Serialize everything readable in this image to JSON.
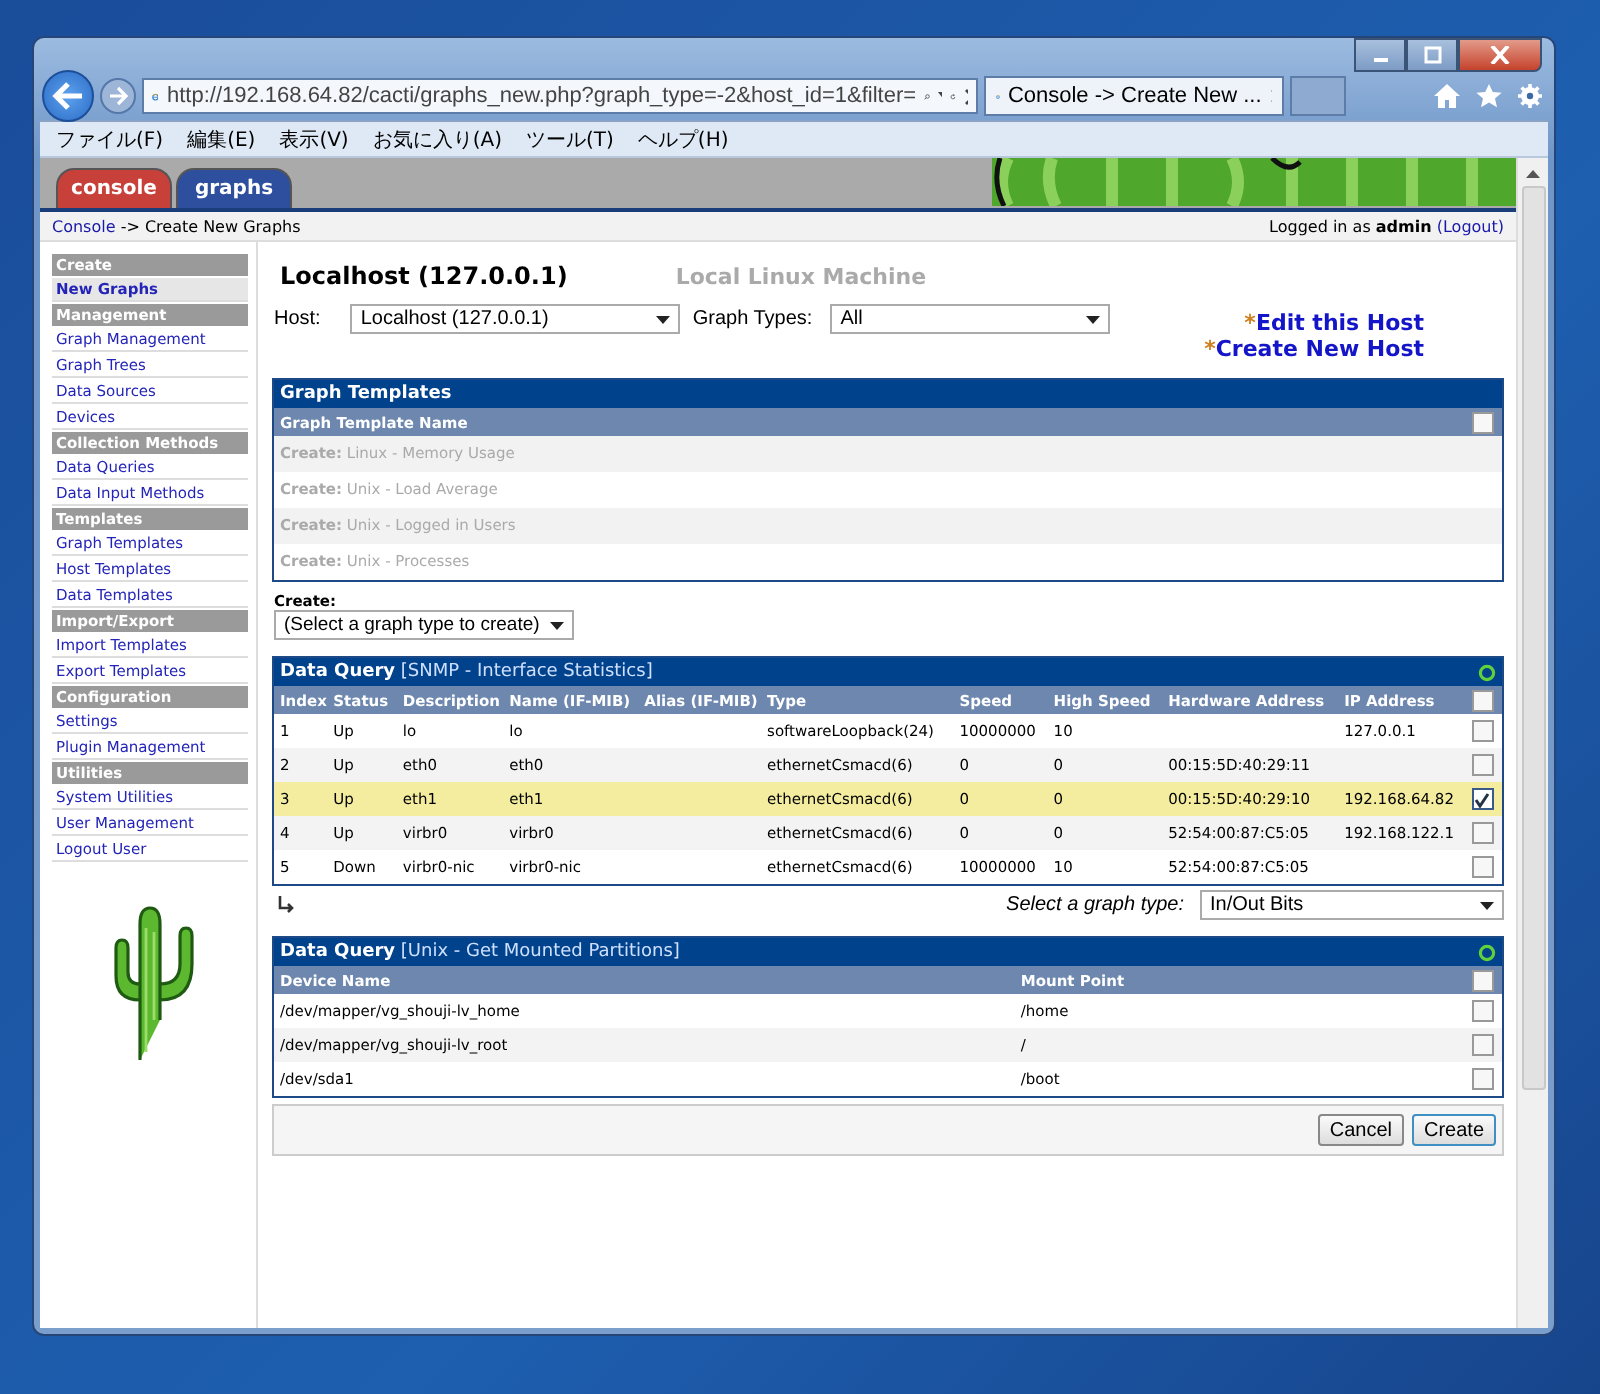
{
  "browser": {
    "url": "http://192.168.64.82/cacti/graphs_new.php?graph_type=-2&host_id=1&filter=",
    "tab_title": "Console -> Create New ...",
    "menu": [
      "ファイル(F)",
      "編集(E)",
      "表示(V)",
      "お気に入り(A)",
      "ツール(T)",
      "ヘルプ(H)"
    ]
  },
  "header_tabs": [
    {
      "label": "console",
      "color": "#c8403a"
    },
    {
      "label": "graphs",
      "color": "#2d4f9e"
    }
  ],
  "breadcrumb": {
    "link": "Console",
    "rest": "-> Create New Graphs",
    "login": "Logged in as **admin**",
    "logout": "(Logout)"
  },
  "sidebar": [
    {
      "kind": "header",
      "label": "Create"
    },
    {
      "kind": "link",
      "label": "New Graphs",
      "selected": true
    },
    {
      "kind": "header",
      "label": "Management"
    },
    {
      "kind": "link",
      "label": "Graph Management",
      "selected": false
    },
    {
      "kind": "link",
      "label": "Graph Trees",
      "selected": false
    },
    {
      "kind": "link",
      "label": "Data Sources",
      "selected": false
    },
    {
      "kind": "link",
      "label": "Devices",
      "selected": false
    },
    {
      "kind": "header",
      "label": "Collection Methods"
    },
    {
      "kind": "link",
      "label": "Data Queries",
      "selected": false
    },
    {
      "kind": "link",
      "label": "Data Input Methods",
      "selected": false
    },
    {
      "kind": "header",
      "label": "Templates"
    },
    {
      "kind": "link",
      "label": "Graph Templates",
      "selected": false
    },
    {
      "kind": "link",
      "label": "Host Templates",
      "selected": false
    },
    {
      "kind": "link",
      "label": "Data Templates",
      "selected": false
    },
    {
      "kind": "header",
      "label": "Import/Export"
    },
    {
      "kind": "link",
      "label": "Import Templates",
      "selected": false
    },
    {
      "kind": "link",
      "label": "Export Templates",
      "selected": false
    },
    {
      "kind": "header",
      "label": "Configuration"
    },
    {
      "kind": "link",
      "label": "Settings",
      "selected": false
    },
    {
      "kind": "link",
      "label": "Plugin Management",
      "selected": false
    },
    {
      "kind": "header",
      "label": "Utilities"
    },
    {
      "kind": "link",
      "label": "System Utilities",
      "selected": false
    },
    {
      "kind": "link",
      "label": "User Management",
      "selected": false
    },
    {
      "kind": "link",
      "label": "Logout User",
      "selected": false
    }
  ],
  "host": {
    "title": "Localhost (127.0.0.1)",
    "description": "Local Linux Machine",
    "host_label": "Host:",
    "host_value": "Localhost (127.0.0.1)",
    "types_label": "Graph Types:",
    "types_value": "All",
    "links": [
      {
        "star": "*",
        "text": "Edit this Host"
      },
      {
        "star": "*",
        "text": "Create New Host"
      }
    ]
  },
  "graph_templates": {
    "title": "Graph Templates",
    "column": "Graph Template Name",
    "header_checked": false,
    "rows": [
      {
        "prefix": "Create:",
        "name": "Linux - Memory Usage"
      },
      {
        "prefix": "Create:",
        "name": "Unix - Load Average"
      },
      {
        "prefix": "Create:",
        "name": "Unix - Logged in Users"
      },
      {
        "prefix": "Create:",
        "name": "Unix - Processes"
      }
    ],
    "create_label": "Create:",
    "create_value": "(Select a graph type to create)"
  },
  "data_queries": [
    {
      "title": "Data Query",
      "subtitle": "[SNMP - Interface Statistics]",
      "header_checked": false,
      "columns": [
        "Index",
        "Status",
        "Description",
        "Name (IF-MIB)",
        "Alias (IF-MIB)",
        "Type",
        "Speed",
        "High Speed",
        "Hardware Address",
        "IP Address"
      ],
      "rows": [
        {
          "cells": [
            "1",
            "Up",
            "lo",
            "lo",
            "",
            "softwareLoopback(24)",
            "10000000",
            "10",
            "",
            "127.0.0.1"
          ],
          "checked": false
        },
        {
          "cells": [
            "2",
            "Up",
            "eth0",
            "eth0",
            "",
            "ethernetCsmacd(6)",
            "0",
            "0",
            "00:15:5D:40:29:11",
            ""
          ],
          "checked": false
        },
        {
          "cells": [
            "3",
            "Up",
            "eth1",
            "eth1",
            "",
            "ethernetCsmacd(6)",
            "0",
            "0",
            "00:15:5D:40:29:10",
            "192.168.64.82"
          ],
          "checked": true
        },
        {
          "cells": [
            "4",
            "Up",
            "virbr0",
            "virbr0",
            "",
            "ethernetCsmacd(6)",
            "0",
            "0",
            "52:54:00:87:C5:05",
            "192.168.122.1"
          ],
          "checked": false
        },
        {
          "cells": [
            "5",
            "Down",
            "virbr0-nic",
            "virbr0-nic",
            "",
            "ethernetCsmacd(6)",
            "10000000",
            "10",
            "52:54:00:87:C5:05",
            ""
          ],
          "checked": false
        }
      ],
      "select_label": "Select a graph type:",
      "select_value": "In/Out Bits"
    },
    {
      "title": "Data Query",
      "subtitle": "[Unix - Get Mounted Partitions]",
      "header_checked": false,
      "columns": [
        "Device Name",
        "Mount Point"
      ],
      "rows": [
        {
          "cells": [
            "/dev/mapper/vg_shouji-lv_home",
            "/home"
          ],
          "checked": false
        },
        {
          "cells": [
            "/dev/mapper/vg_shouji-lv_root",
            "/"
          ],
          "checked": false
        },
        {
          "cells": [
            "/dev/sda1",
            "/boot"
          ],
          "checked": false
        }
      ]
    }
  ],
  "buttons": [
    {
      "label": "Cancel",
      "kind": "secondary"
    },
    {
      "label": "Create",
      "kind": "primary"
    }
  ]
}
